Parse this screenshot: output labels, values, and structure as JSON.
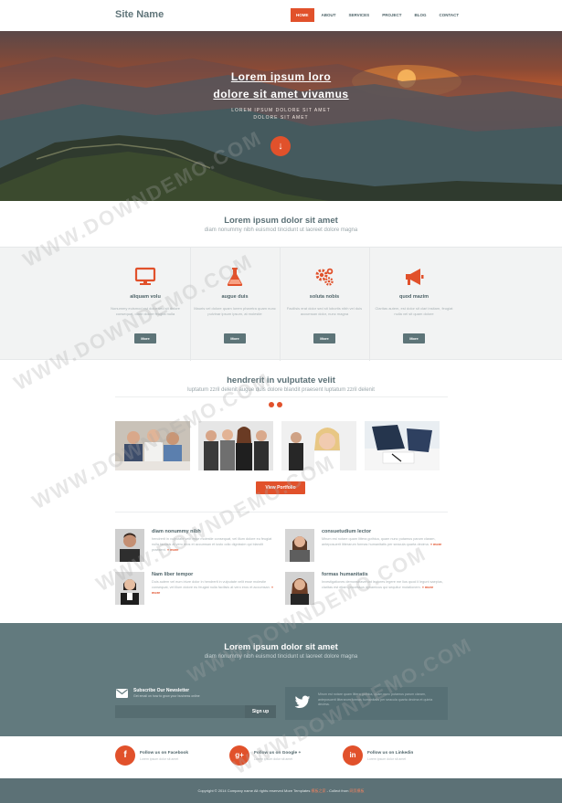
{
  "nav": {
    "site_name": "Site Name",
    "menu": [
      "HOME",
      "ABOUT",
      "SERVICES",
      "PROJECT",
      "BLOG",
      "CONTACT"
    ],
    "active_index": 0
  },
  "hero": {
    "title_line1": "Lorem ipsum loro",
    "title_line2": "dolore sit amet vivamus",
    "sub_line1": "LOREM IPSUM DOLORE SIT AMET",
    "sub_line2": "DOLORE SIT AMET",
    "button_glyph": "↓"
  },
  "intro": {
    "title": "Lorem ipsum dolor sit amet",
    "subtitle": "diam nonummy nibh euismod tincidunt ut laoreet dolore magna"
  },
  "features": [
    {
      "icon": "monitor-icon",
      "title": "aliquam volu",
      "text": "Nonummy euismod est dolor sed sit dolore consequat, diam dolore feugiat nulla",
      "button": "More"
    },
    {
      "icon": "flask-icon",
      "title": "augue duis",
      "text": "Mauris vel dolore quam lorem pharetra quam nunc pulvinar ipsum ipsum, at molestie",
      "button": "More"
    },
    {
      "icon": "gears-icon",
      "title": "soluta nobis",
      "text": "Facilisis erat dolor sed sit lobortis nibh vel duis accumsan dolor, nunc magna",
      "button": "More"
    },
    {
      "icon": "megaphone-icon",
      "title": "quod mazim",
      "text": "Claritas autem, est dolor sit clari insitam, feugiat nulla vel sit quam dolore",
      "button": "More"
    }
  ],
  "portfolio": {
    "title": "hendrerit in vulputate velit",
    "subtitle": "luptatum zzril delenit augue duis dolore blandit praesent luptatum zzril delenit",
    "button": "View Portfolio"
  },
  "team": [
    {
      "name": "diam nonummy nibh",
      "text": "hendrerit in vulputate velit esse molestie consequat, vel illum dolore eu feugiat nulla facilisis at vero eros et accumsan et iusto odio dignissim qui blandit praesent.",
      "more": "» more"
    },
    {
      "name": "consuetudium lector",
      "text": "Mirum est notare quam littera gothica, quam nunc putamus parum claram, anteposuerit litterarum formas humanitatis per seacula quarta decima.",
      "more": "» more"
    },
    {
      "name": "Nam liber tempor",
      "text": "Duis autem vel eum iriure dolor in hendrerit in vulputate velit esse molestie consequat, vel illum dolore eu feugiat nulla facilisis at vero eros et accumsan.",
      "more": "» more"
    },
    {
      "name": "formas humanitatis",
      "text": "Investigationes demonstraverunt lectores legere me lius quod ii legunt saepius, claritas est etiam processus dynamicus qui sequitur mutationem.",
      "more": "» more"
    }
  ],
  "newsletter": {
    "title": "Lorem ipsum dolor sit amet",
    "subtitle": "diam nonummy nibh euismod tincidunt ut laoreet dolore magna",
    "box_title": "Subscribe Our Newsletter",
    "box_sub": "Get email on how to grow your business online",
    "input_placeholder": "",
    "button": "Sign up",
    "tweet": "Mirum est notare quam littera gothica, quam nunc putamus parum claram, anteposuerit litterarum formas humanitatis per seacula quarta decima et quinta decima."
  },
  "social": [
    {
      "glyph": "f",
      "icon": "facebook-icon",
      "title": "Follow us on Facebook",
      "sub": "Lorem ipsum dolor sit amet"
    },
    {
      "glyph": "g+",
      "icon": "google-plus-icon",
      "title": "Follow us on Google +",
      "sub": "Lorem ipsum dolor sit amet"
    },
    {
      "glyph": "in",
      "icon": "linkedin-icon",
      "title": "Follow us on Linkedin",
      "sub": "Lorem ipsum dolor sit amet"
    }
  ],
  "footer": {
    "copyright": "Copyright © 2014 Company name All rights reserved",
    "templates_label": "More Templates",
    "templates_link": "模板之家",
    "collect_label": "- Collect from",
    "collect_link": "网页模板"
  },
  "watermark": "WWW.DOWNDEMO.COM",
  "colors": {
    "accent": "#e1512b",
    "slate": "#627a7e",
    "heading": "#5b7076"
  }
}
